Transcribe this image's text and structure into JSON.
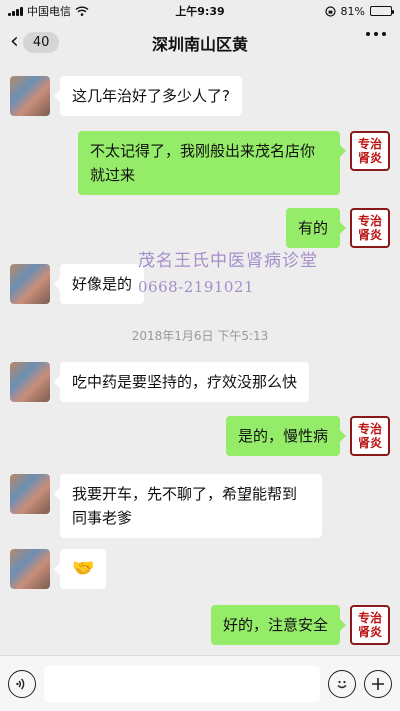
{
  "status_bar": {
    "carrier": "中国电信",
    "time": "上午9:39",
    "battery_percent": "81%",
    "battery_level": 0.81
  },
  "nav": {
    "back_count": "40",
    "title": "深圳南山区黄"
  },
  "avatar_doc": {
    "line1": "专治",
    "line2": "肾炎"
  },
  "messages": [
    {
      "side": "left",
      "text": "这几年治好了多少人了?"
    },
    {
      "side": "right",
      "text": "不太记得了，我刚般出来茂名店你就过来"
    },
    {
      "side": "right",
      "text": "有的"
    },
    {
      "side": "left",
      "text": "好像是的"
    },
    {
      "side": "left",
      "text": "吃中药是要坚持的，疗效没那么快"
    },
    {
      "side": "right",
      "text": "是的，慢性病"
    },
    {
      "side": "left",
      "text": "我要开车，先不聊了，希望能帮到同事老爹"
    },
    {
      "side": "left",
      "text": "🤝"
    },
    {
      "side": "right",
      "text": "好的，注意安全"
    }
  ],
  "timestamp": "2018年1月6日 下午5:13",
  "watermark": {
    "name": "茂名王氏中医肾病诊堂",
    "phone": "0668-2191021"
  },
  "input_bar": {
    "placeholder": "",
    "icons": [
      "voice-icon",
      "emoji-icon",
      "plus-icon"
    ]
  },
  "colors": {
    "background": "#ededed",
    "sent_bubble": "#95ec69",
    "received_bubble": "#ffffff",
    "watermark": "#a58ec9"
  }
}
